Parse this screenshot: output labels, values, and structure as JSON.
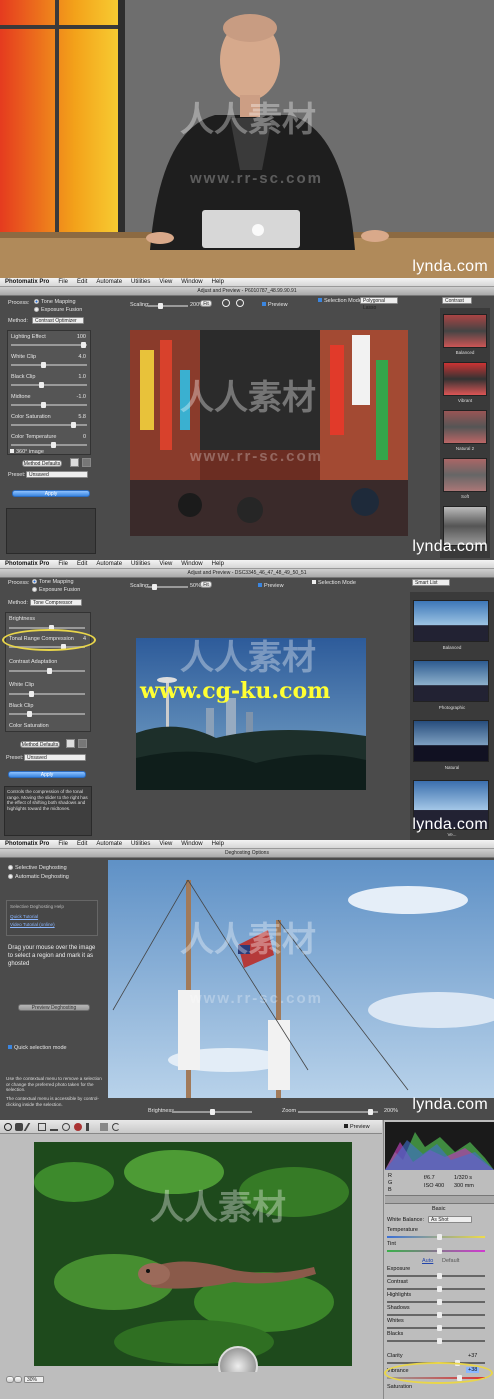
{
  "colors": {
    "accent": "#3b86e0",
    "highlight_ring": "#e9d64a",
    "overlay_url": "#ffff33"
  },
  "brand": {
    "lynda_text": "lynda.com"
  },
  "watermark": {
    "mark": "人人素材",
    "url": "www.rr-sc.com"
  },
  "overlay_site": "www.cg-ku.com",
  "panel2": {
    "menu": [
      "Photomatix Pro",
      "File",
      "Edit",
      "Automate",
      "Utilities",
      "View",
      "Window",
      "Help"
    ],
    "window_title": "Adjust and Preview - P6010787_48.99.90.91",
    "process_label": "Process:",
    "process_options": [
      "Tone Mapping",
      "Exposure Fusion"
    ],
    "method_label": "Method:",
    "method_value": "Contrast Optimizer",
    "sliders": [
      {
        "label": "Lighting Effect",
        "value": "100"
      },
      {
        "label": "White Clip",
        "value": "4.0"
      },
      {
        "label": "Black Clip",
        "value": "1.0"
      },
      {
        "label": "Midtone",
        "value": "-1.0"
      },
      {
        "label": "Color Saturation",
        "value": "5.8"
      },
      {
        "label": "Color Temperature",
        "value": "0"
      }
    ],
    "check_360": "360° image",
    "method_defaults": "Method Defaults",
    "preset_label": "Preset:",
    "preset_value": "Unsaved",
    "apply": "Apply",
    "scaling_label": "Scaling:",
    "scaling_pct": "200%",
    "fit": "Fit",
    "preview": "Preview",
    "selection_mode": "Selection Mode",
    "selection_select": "Polygonal Lasso",
    "contrast_select": "Contrast",
    "thumbs": [
      "Balanced",
      "Vibrant",
      "Natural 2",
      "Soft",
      ""
    ]
  },
  "panel3": {
    "menu": [
      "Photomatix Pro",
      "File",
      "Edit",
      "Automate",
      "Utilities",
      "View",
      "Window",
      "Help"
    ],
    "window_title": "Adjust and Preview - DSC3345_46_47_48_49_50_51",
    "process_label": "Process:",
    "process_options": [
      "Tone Mapping",
      "Exposure Fusion"
    ],
    "method_label": "Method:",
    "method_value": "Tone Compressor",
    "sliders": [
      {
        "label": "Brightness",
        "value": ""
      },
      {
        "label": "Tonal Range Compression",
        "value": "4"
      },
      {
        "label": "Contrast Adaptation",
        "value": ""
      },
      {
        "label": "White Clip",
        "value": ""
      },
      {
        "label": "Black Clip",
        "value": ""
      },
      {
        "label": "Color Saturation",
        "value": ""
      }
    ],
    "method_defaults": "Method Defaults",
    "preset_label": "Preset:",
    "preset_value": "Unsaved",
    "apply": "Apply",
    "help_text": "Controls the compression of the tonal range. Moving the slider to the right has the effect of shifting both shadows and highlights toward the midtones.",
    "scaling_label": "Scaling:",
    "scaling_pct": "50%",
    "fit": "Fit",
    "preview": "Preview",
    "selection_mode": "Selection Mode",
    "smart_list": "Smart List",
    "thumbs": [
      "Balanced",
      "Photographic",
      "Natural",
      "Ve..."
    ]
  },
  "panel4": {
    "menu": [
      "Photomatix Pro",
      "File",
      "Edit",
      "Automate",
      "Utilities",
      "View",
      "Window",
      "Help"
    ],
    "window_title": "Deghosting Options",
    "options": [
      "Selective Deghosting",
      "Automatic Deghosting"
    ],
    "help_header": "Selective Deghosting Help",
    "help_links": [
      "Quick Tutorial",
      "Video Tutorial (online)"
    ],
    "instruction": "Drag your mouse over the image to select a region and mark it as ghosted",
    "preview_btn": "Preview Deghosting",
    "quick_sel": "Quick selection mode",
    "note1": "Use the contextual menu to remove a selection or change the preferred photo taken for the selection.",
    "note2": "The contextual menu is accessible by control-clicking inside the selection.",
    "brightness": "Brightness",
    "zoom": "Zoom",
    "zoom_pct": "200%"
  },
  "panel5": {
    "preview": "Preview",
    "zoom_pct": "30%",
    "info": {
      "r": "R",
      "g": "G",
      "b": "B",
      "aperture": "f/6.7",
      "shutter": "1/320 s",
      "iso": "ISO 400",
      "focal": "300 mm"
    },
    "tab": "Basic",
    "white_balance_label": "White Balance:",
    "white_balance_value": "As Shot",
    "rows": [
      "Temperature",
      "Tint",
      "Exposure",
      "Contrast",
      "Highlights",
      "Shadows",
      "Whites",
      "Blacks",
      "Clarity",
      "Vibrance",
      "Saturation"
    ],
    "auto": "Auto",
    "default": "Default",
    "clarity_value": "+37",
    "vibrance_value": "+38"
  }
}
